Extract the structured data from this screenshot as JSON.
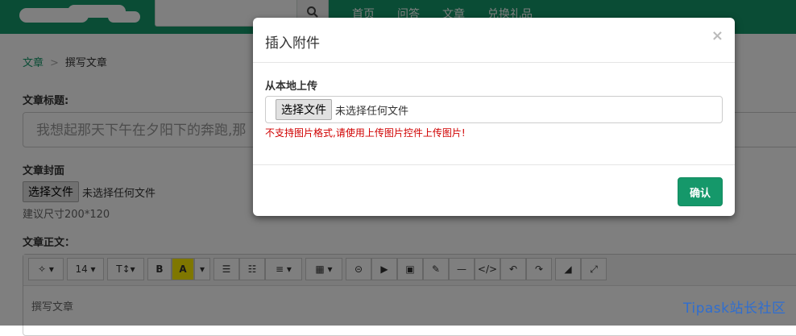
{
  "nav": {
    "items": [
      "首页",
      "问答",
      "文章",
      "兑换礼品"
    ]
  },
  "page": {
    "breadcrumb": {
      "parent": "文章",
      "separator": ">",
      "current": "撰写文章"
    },
    "title_label": "文章标题:",
    "title_value": "我想起那天下午在夕阳下的奔跑,那",
    "cover_label": "文章封面",
    "cover_button": "选择文件",
    "cover_status": "未选择任何文件",
    "cover_hint": "建议尺寸200*120",
    "body_label": "文章正文：",
    "toolbar": {
      "font_size": "14"
    },
    "editor_placeholder": "撰写文章"
  },
  "modal": {
    "title": "插入附件",
    "close": "×",
    "upload_label": "从本地上传",
    "file_button": "选择文件",
    "file_status": "未选择任何文件",
    "error": "不支持图片格式,请使用上传图片控件上传图片!",
    "confirm": "确认"
  },
  "watermark": "Tipask站长社区",
  "colors": {
    "brand": "#15986a",
    "error": "#d00000",
    "watermark": "#2f6ed0"
  }
}
